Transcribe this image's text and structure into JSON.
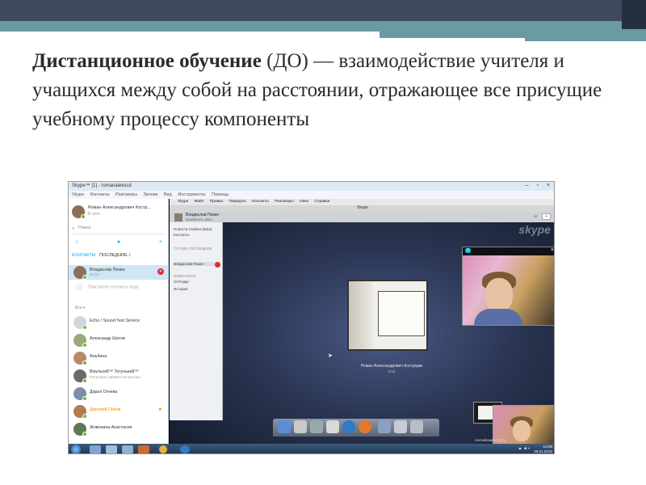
{
  "slide": {
    "heading_bold": "Дистанционное обучение",
    "heading_rest": " (ДО) — взаимодействие учителя и учащихся между собой на расстоянии, отражающее все присущие учебному процессу компоненты"
  },
  "skype": {
    "window_title": "Skype™ [1] - romanalekscd",
    "menu": [
      "Skype",
      "Контакты",
      "Разговоры",
      "Звонки",
      "Вид",
      "Инструменты",
      "Помощь"
    ],
    "profile_name": "Роман Александрович Костр...",
    "profile_status": "В сети",
    "search_placeholder": "Поиск",
    "tab_contacts": "КОНТАКТЫ",
    "tab_recent": "ПОСЛЕДНИЕ",
    "tab_recent_count": "1",
    "active_contact": {
      "name": "Владислав Пекин",
      "sub": "01:02"
    },
    "add_contact": "Пригласите контакты сюда",
    "group_label": "Все ▾",
    "contacts": [
      {
        "name": "Echo / Sound Test Service",
        "sub": ""
      },
      {
        "name": "Александр Шатов",
        "sub": ""
      },
      {
        "name": "Альбина",
        "sub": ""
      },
      {
        "name": "Вікульок8™ Тетунька8™",
        "sub": "Получено приветств контакт"
      },
      {
        "name": "Дарья Огнева",
        "sub": ""
      },
      {
        "name": "Дмитрий Попов",
        "sub": ""
      },
      {
        "name": "Жовонина Анастасия",
        "sub": ""
      }
    ]
  },
  "mac": {
    "menubar": [
      "Skype",
      "Файл",
      "Правка",
      "Передать",
      "Контакты",
      "Разговоры",
      "Окно",
      "Справка"
    ],
    "window_title": "Skype",
    "header_name": "Владислав Пекин",
    "header_sub": "Балансить звон",
    "side": [
      "Новости Скайпа (Beta)",
      "Контакты",
      "ТУСЯДА ПОСЛЕДНИЕ",
      "Владислав Пекин",
      "ИЗБРАННОЕ",
      "ЗАРАДЫ",
      "История"
    ],
    "logo": "skype",
    "callee_name": "Роман Александрович Костріции",
    "call_time": "0:02",
    "lang": "Английский (США)"
  },
  "taskbar": {
    "time": "13:08",
    "date": "19.01.2016"
  }
}
